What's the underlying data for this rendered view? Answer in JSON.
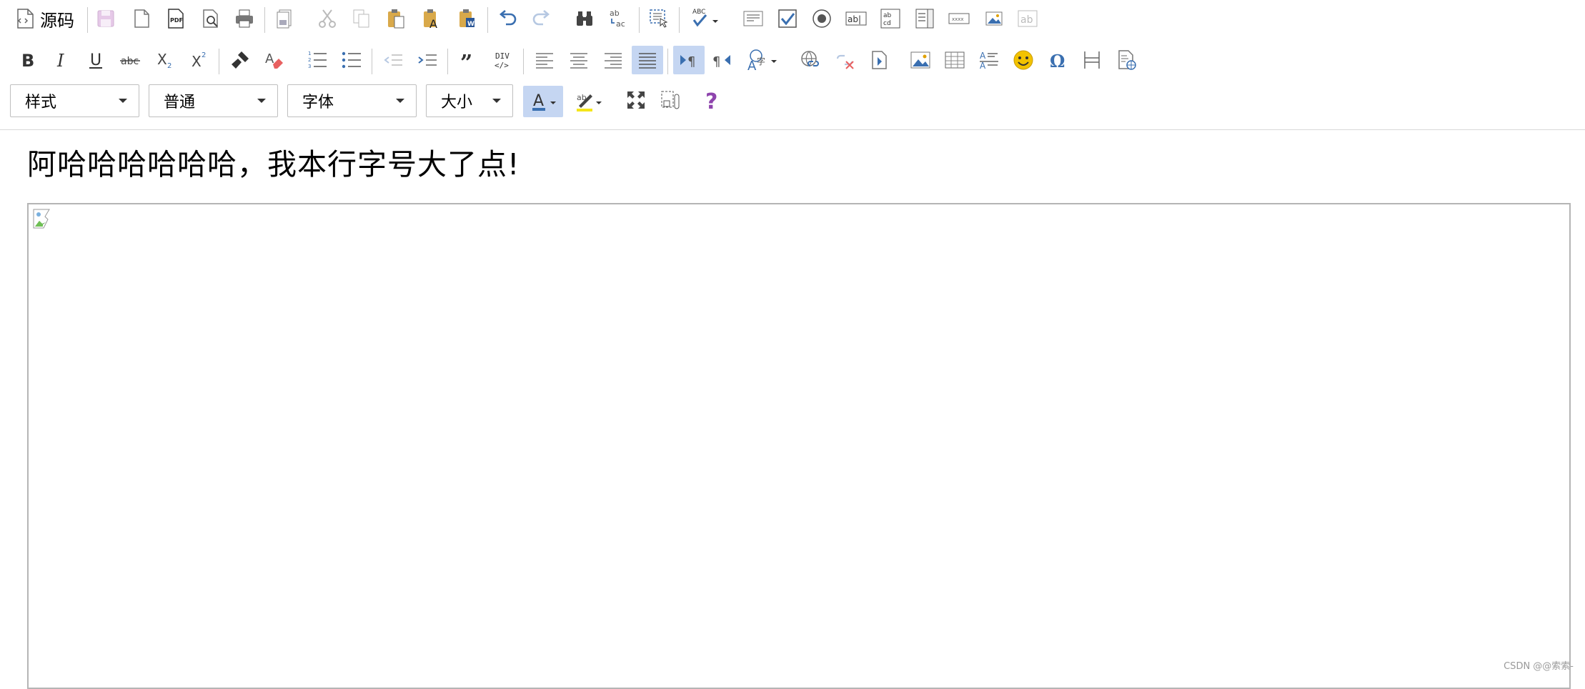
{
  "toolbar": {
    "source_label": "源码",
    "combos": {
      "style": "样式",
      "format": "普通",
      "font": "字体",
      "size": "大小"
    },
    "colors": {
      "accent": "#3a6fb0",
      "active_bg": "#c5d6f2",
      "disabled": "#cfcfcf",
      "help": "#8e44ad",
      "emoji": "#f2c200",
      "highlight": "#f5e51a",
      "link_remove": "#e86060"
    }
  },
  "content": {
    "headline": "阿哈哈哈哈哈哈，我本行字号大了点!"
  },
  "watermark": "CSDN @@索索-"
}
